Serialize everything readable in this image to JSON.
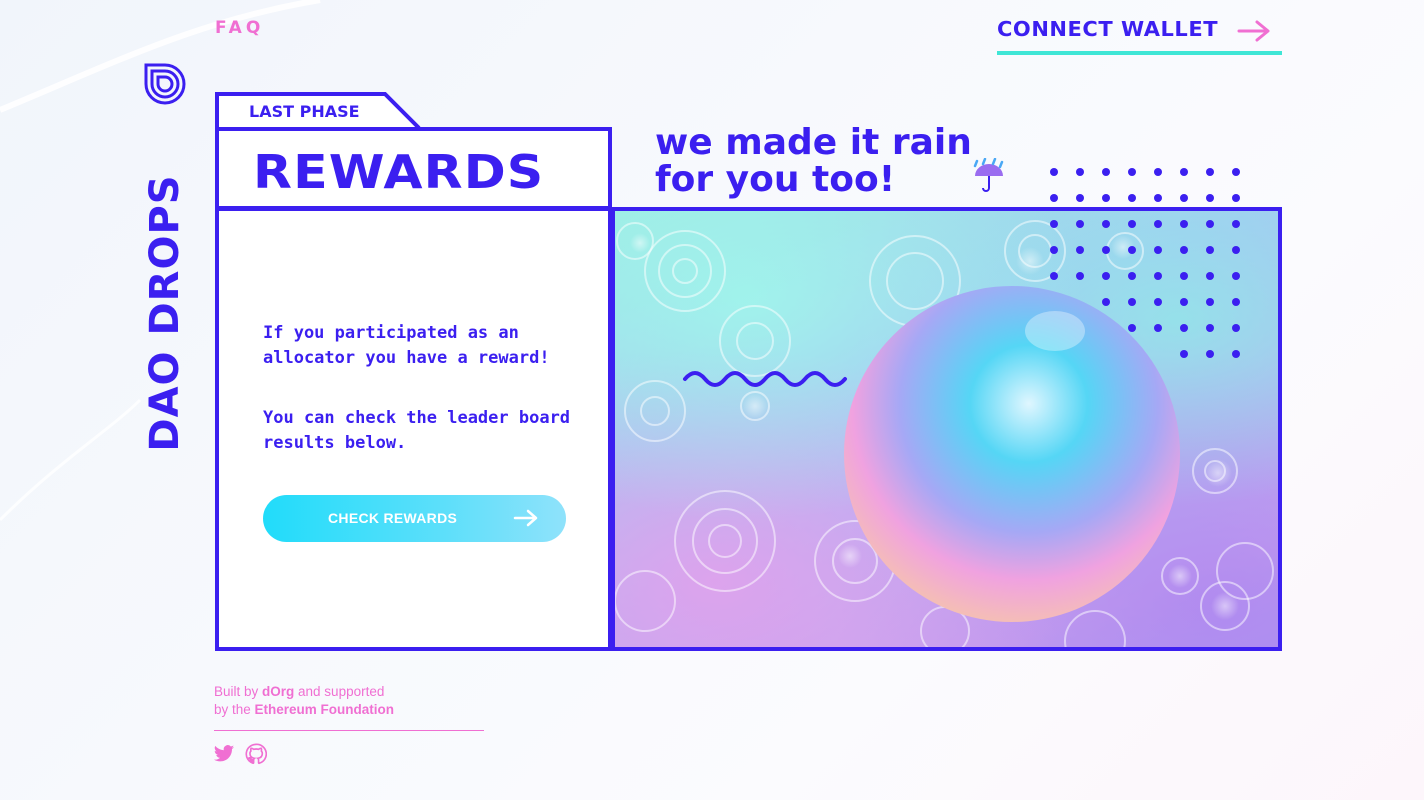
{
  "nav": {
    "faq_label": "FAQ",
    "connect_label": "CONNECT WALLET"
  },
  "brand": {
    "name": "DAO DROPS"
  },
  "card": {
    "tab_label": "LAST PHASE",
    "title": "REWARDS",
    "paragraph_1": "If you participated as an allocator you have a reward!",
    "paragraph_2": "You can check the leader board results below.",
    "button_label": "CHECK REWARDS"
  },
  "hero": {
    "headline_line_1": "we made it rain",
    "headline_line_2": "for you too!",
    "emoji": "umbrella-with-rain-icon"
  },
  "footer": {
    "built_by_prefix": "Built by ",
    "built_by_org": "dOrg",
    "built_by_suffix": " and supported",
    "by_the_prefix": "by the ",
    "supporter": "Ethereum Foundation",
    "social": [
      "twitter-icon",
      "github-icon"
    ]
  },
  "colors": {
    "primary": "#3b1ff0",
    "accent_pink": "#f06fd2",
    "accent_teal": "#3fe6d6",
    "button_cyan": "#21dcfa"
  }
}
